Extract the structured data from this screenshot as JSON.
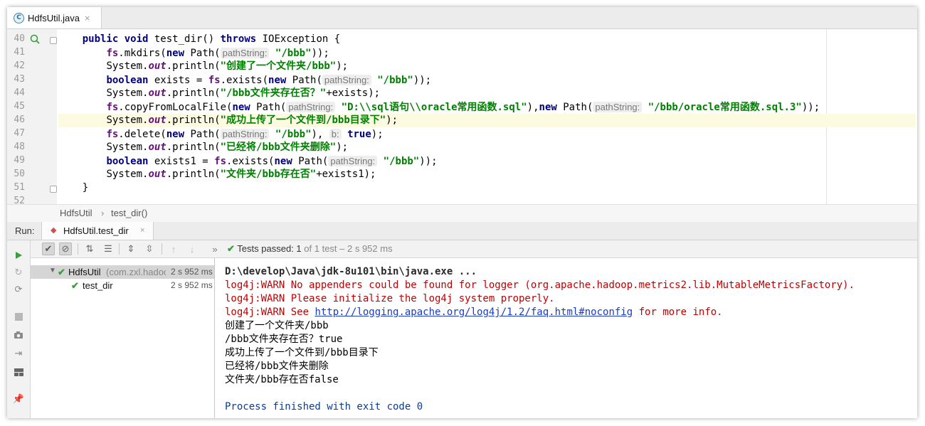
{
  "editor_tab": {
    "icon": "C",
    "title": "HdfsUtil.java",
    "close": "×"
  },
  "gutter": {
    "line_numbers": [
      "40",
      "41",
      "42",
      "43",
      "44",
      "45",
      "46",
      "47",
      "48",
      "49",
      "50",
      "51",
      "52"
    ]
  },
  "code": {
    "l40": {
      "kw1": "public",
      "kw2": "void",
      "t1": " test_dir() ",
      "kw3": "throws",
      "t2": " IOException {"
    },
    "l41": {
      "fld": "fs",
      "t1": ".mkdirs(",
      "kw": "new",
      "t2": " Path(",
      "hint": "pathString:",
      "str": "\"/bbb\"",
      "t3": "));"
    },
    "l42": {
      "t1": "System.",
      "sfld": "out",
      "t2": ".println(",
      "str": "\"创建了一个文件夹/bbb\"",
      "t3": ");"
    },
    "l43": {
      "kw1": "boolean",
      "t1": " exists = ",
      "fld": "fs",
      "t2": ".exists(",
      "kw2": "new",
      "t3": " Path(",
      "hint": "pathString:",
      "str": "\"/bbb\"",
      "t4": "));"
    },
    "l44": {
      "t1": "System.",
      "sfld": "out",
      "t2": ".println(",
      "str": "\"/bbb文件夹存在否？\"",
      "t3": "+exists);"
    },
    "l45": {
      "fld": "fs",
      "t1": ".copyFromLocalFile(",
      "kw1": "new",
      "t2": " Path(",
      "hint1": "pathString:",
      "str1": "\"D:\\\\sql语句\\\\oracle常用函数.sql\"",
      "t3": "),",
      "kw2": "new",
      "t4": " Path(",
      "hint2": "pathString:",
      "str2": "\"/bbb/oracle常用函数.sql.3\"",
      "t5": "));"
    },
    "l46": {
      "t1": "System.",
      "sfld": "out",
      "t2": ".println(",
      "str": "\"成功上传了一个文件到/bbb目录下\"",
      "t3": ");"
    },
    "l47": {
      "fld": "fs",
      "t1": ".delete(",
      "kw1": "new",
      "t2": " Path(",
      "hint1": "pathString:",
      "str": "\"/bbb\"",
      "t3": "), ",
      "hint2": "b:",
      "kw2": "true",
      "t4": ");"
    },
    "l48": {
      "t1": "System.",
      "sfld": "out",
      "t2": ".println(",
      "str": "\"已经将/bbb文件夹删除\"",
      "t3": ");"
    },
    "l49": {
      "kw1": "boolean",
      "t1": " exists1 = ",
      "fld": "fs",
      "t2": ".exists(",
      "kw2": "new",
      "t3": " Path(",
      "hint": "pathString:",
      "str": "\"/bbb\"",
      "t4": "));"
    },
    "l50": {
      "t1": "System.",
      "sfld": "out",
      "t2": ".println(",
      "str": "\"文件夹/bbb存在否\"",
      "t3": "+exists1);"
    },
    "l51": {
      "t1": "}"
    }
  },
  "breadcrumb": {
    "class": "HdfsUtil",
    "sep": "›",
    "method": "test_dir()"
  },
  "run_panel": {
    "label": "Run:",
    "tab_title": "HdfsUtil.test_dir",
    "tab_close": "×"
  },
  "toolbar": {
    "more": "»",
    "status_check": "✔",
    "status_prefix": "Tests passed:",
    "status_count": "1",
    "status_suffix": "of 1 test – 2 s 952 ms"
  },
  "test_tree": {
    "root": {
      "name": "HdfsUtil",
      "package": "(com.zxl.hadoo",
      "time": "2 s 952 ms"
    },
    "child": {
      "name": "test_dir",
      "time": "2 s 952 ms"
    }
  },
  "console": {
    "line1": "D:\\develop\\Java\\jdk-8u101\\bin\\java.exe ...",
    "line2": "log4j:WARN No appenders could be found for logger (org.apache.hadoop.metrics2.lib.MutableMetricsFactory).",
    "line3": "log4j:WARN Please initialize the log4j system properly.",
    "line4_pre": "log4j:WARN See ",
    "line4_link": "http://logging.apache.org/log4j/1.2/faq.html#noconfig",
    "line4_post": " for more info.",
    "line5": "创建了一个文件夹/bbb",
    "line6": "/bbb文件夹存在否？true",
    "line7": "成功上传了一个文件到/bbb目录下",
    "line8": "已经将/bbb文件夹删除",
    "line9": "文件夹/bbb存在否false",
    "line10": "Process finished with exit code 0"
  },
  "colors": {
    "keyword": "#000080",
    "string": "#008000",
    "field": "#660e7a",
    "warn": "#c00000",
    "pass": "#3c9d3c"
  }
}
